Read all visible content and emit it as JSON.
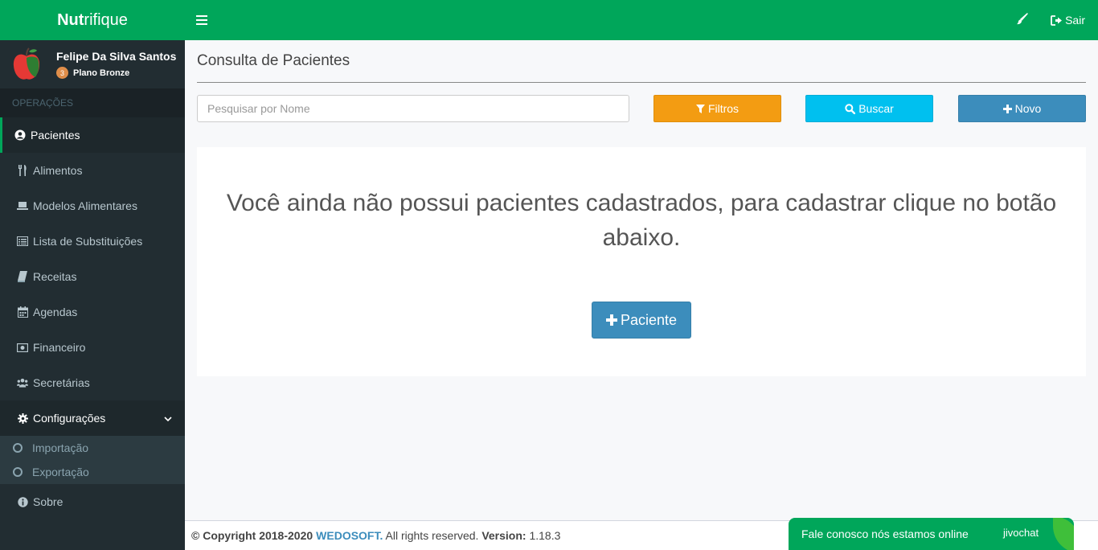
{
  "app": {
    "brand_bold": "Nut",
    "brand_rest": "rifique"
  },
  "user": {
    "name": "Felipe Da Silva Santos",
    "plan_level": "3",
    "plan_name": "Plano Bronze"
  },
  "sidebar": {
    "section": "OPERAÇÕES",
    "items": [
      {
        "label": "Pacientes",
        "icon": "user-circle-icon"
      },
      {
        "label": "Alimentos",
        "icon": "utensils-icon"
      },
      {
        "label": "Modelos Alimentares",
        "icon": "laptop-icon"
      },
      {
        "label": "Lista de Substituições",
        "icon": "list-alt-icon"
      },
      {
        "label": "Receitas",
        "icon": "book-icon"
      },
      {
        "label": "Agendas",
        "icon": "calendar-icon"
      },
      {
        "label": "Financeiro",
        "icon": "money-icon"
      },
      {
        "label": "Secretárias",
        "icon": "users-icon"
      },
      {
        "label": "Configurações",
        "icon": "gear-icon"
      }
    ],
    "subitems": [
      {
        "label": "Importação"
      },
      {
        "label": "Exportação"
      }
    ],
    "about": {
      "label": "Sobre",
      "icon": "info-icon"
    }
  },
  "topbar": {
    "logout_label": "Sair"
  },
  "main": {
    "title": "Consulta de Pacientes",
    "search_placeholder": "Pesquisar por Nome",
    "filter_label": "Filtros",
    "search_label": "Buscar",
    "new_label": "Novo",
    "empty_message": "Você ainda não possui pacientes cadastrados, para cadastrar clique no botão abaixo.",
    "add_patient_label": "Paciente"
  },
  "footer": {
    "copyright": "© Copyright 2018-2020",
    "company": "WEDOSOFT.",
    "rights": " All rights reserved. ",
    "version_label": "Version:",
    "version": " 1.18.3"
  },
  "chat": {
    "message": "Fale conosco nós estamos online",
    "brand": "jivochat"
  },
  "colors": {
    "primary_green": "#00a65a",
    "sidebar": "#222d32",
    "filter": "#f39c12",
    "search": "#00c0ef",
    "new": "#3c8dbc"
  }
}
